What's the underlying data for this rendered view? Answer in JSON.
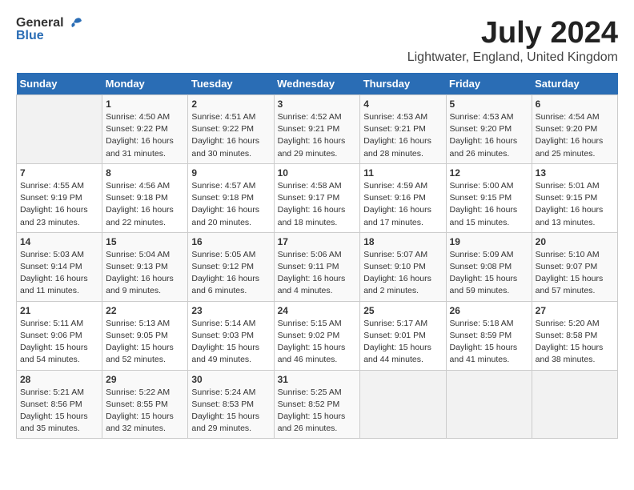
{
  "logo": {
    "general": "General",
    "blue": "Blue"
  },
  "title": "July 2024",
  "subtitle": "Lightwater, England, United Kingdom",
  "days_of_week": [
    "Sunday",
    "Monday",
    "Tuesday",
    "Wednesday",
    "Thursday",
    "Friday",
    "Saturday"
  ],
  "weeks": [
    [
      {
        "num": "",
        "data": ""
      },
      {
        "num": "1",
        "data": "Sunrise: 4:50 AM\nSunset: 9:22 PM\nDaylight: 16 hours\nand 31 minutes."
      },
      {
        "num": "2",
        "data": "Sunrise: 4:51 AM\nSunset: 9:22 PM\nDaylight: 16 hours\nand 30 minutes."
      },
      {
        "num": "3",
        "data": "Sunrise: 4:52 AM\nSunset: 9:21 PM\nDaylight: 16 hours\nand 29 minutes."
      },
      {
        "num": "4",
        "data": "Sunrise: 4:53 AM\nSunset: 9:21 PM\nDaylight: 16 hours\nand 28 minutes."
      },
      {
        "num": "5",
        "data": "Sunrise: 4:53 AM\nSunset: 9:20 PM\nDaylight: 16 hours\nand 26 minutes."
      },
      {
        "num": "6",
        "data": "Sunrise: 4:54 AM\nSunset: 9:20 PM\nDaylight: 16 hours\nand 25 minutes."
      }
    ],
    [
      {
        "num": "7",
        "data": "Sunrise: 4:55 AM\nSunset: 9:19 PM\nDaylight: 16 hours\nand 23 minutes."
      },
      {
        "num": "8",
        "data": "Sunrise: 4:56 AM\nSunset: 9:18 PM\nDaylight: 16 hours\nand 22 minutes."
      },
      {
        "num": "9",
        "data": "Sunrise: 4:57 AM\nSunset: 9:18 PM\nDaylight: 16 hours\nand 20 minutes."
      },
      {
        "num": "10",
        "data": "Sunrise: 4:58 AM\nSunset: 9:17 PM\nDaylight: 16 hours\nand 18 minutes."
      },
      {
        "num": "11",
        "data": "Sunrise: 4:59 AM\nSunset: 9:16 PM\nDaylight: 16 hours\nand 17 minutes."
      },
      {
        "num": "12",
        "data": "Sunrise: 5:00 AM\nSunset: 9:15 PM\nDaylight: 16 hours\nand 15 minutes."
      },
      {
        "num": "13",
        "data": "Sunrise: 5:01 AM\nSunset: 9:15 PM\nDaylight: 16 hours\nand 13 minutes."
      }
    ],
    [
      {
        "num": "14",
        "data": "Sunrise: 5:03 AM\nSunset: 9:14 PM\nDaylight: 16 hours\nand 11 minutes."
      },
      {
        "num": "15",
        "data": "Sunrise: 5:04 AM\nSunset: 9:13 PM\nDaylight: 16 hours\nand 9 minutes."
      },
      {
        "num": "16",
        "data": "Sunrise: 5:05 AM\nSunset: 9:12 PM\nDaylight: 16 hours\nand 6 minutes."
      },
      {
        "num": "17",
        "data": "Sunrise: 5:06 AM\nSunset: 9:11 PM\nDaylight: 16 hours\nand 4 minutes."
      },
      {
        "num": "18",
        "data": "Sunrise: 5:07 AM\nSunset: 9:10 PM\nDaylight: 16 hours\nand 2 minutes."
      },
      {
        "num": "19",
        "data": "Sunrise: 5:09 AM\nSunset: 9:08 PM\nDaylight: 15 hours\nand 59 minutes."
      },
      {
        "num": "20",
        "data": "Sunrise: 5:10 AM\nSunset: 9:07 PM\nDaylight: 15 hours\nand 57 minutes."
      }
    ],
    [
      {
        "num": "21",
        "data": "Sunrise: 5:11 AM\nSunset: 9:06 PM\nDaylight: 15 hours\nand 54 minutes."
      },
      {
        "num": "22",
        "data": "Sunrise: 5:13 AM\nSunset: 9:05 PM\nDaylight: 15 hours\nand 52 minutes."
      },
      {
        "num": "23",
        "data": "Sunrise: 5:14 AM\nSunset: 9:03 PM\nDaylight: 15 hours\nand 49 minutes."
      },
      {
        "num": "24",
        "data": "Sunrise: 5:15 AM\nSunset: 9:02 PM\nDaylight: 15 hours\nand 46 minutes."
      },
      {
        "num": "25",
        "data": "Sunrise: 5:17 AM\nSunset: 9:01 PM\nDaylight: 15 hours\nand 44 minutes."
      },
      {
        "num": "26",
        "data": "Sunrise: 5:18 AM\nSunset: 8:59 PM\nDaylight: 15 hours\nand 41 minutes."
      },
      {
        "num": "27",
        "data": "Sunrise: 5:20 AM\nSunset: 8:58 PM\nDaylight: 15 hours\nand 38 minutes."
      }
    ],
    [
      {
        "num": "28",
        "data": "Sunrise: 5:21 AM\nSunset: 8:56 PM\nDaylight: 15 hours\nand 35 minutes."
      },
      {
        "num": "29",
        "data": "Sunrise: 5:22 AM\nSunset: 8:55 PM\nDaylight: 15 hours\nand 32 minutes."
      },
      {
        "num": "30",
        "data": "Sunrise: 5:24 AM\nSunset: 8:53 PM\nDaylight: 15 hours\nand 29 minutes."
      },
      {
        "num": "31",
        "data": "Sunrise: 5:25 AM\nSunset: 8:52 PM\nDaylight: 15 hours\nand 26 minutes."
      },
      {
        "num": "",
        "data": ""
      },
      {
        "num": "",
        "data": ""
      },
      {
        "num": "",
        "data": ""
      }
    ]
  ]
}
